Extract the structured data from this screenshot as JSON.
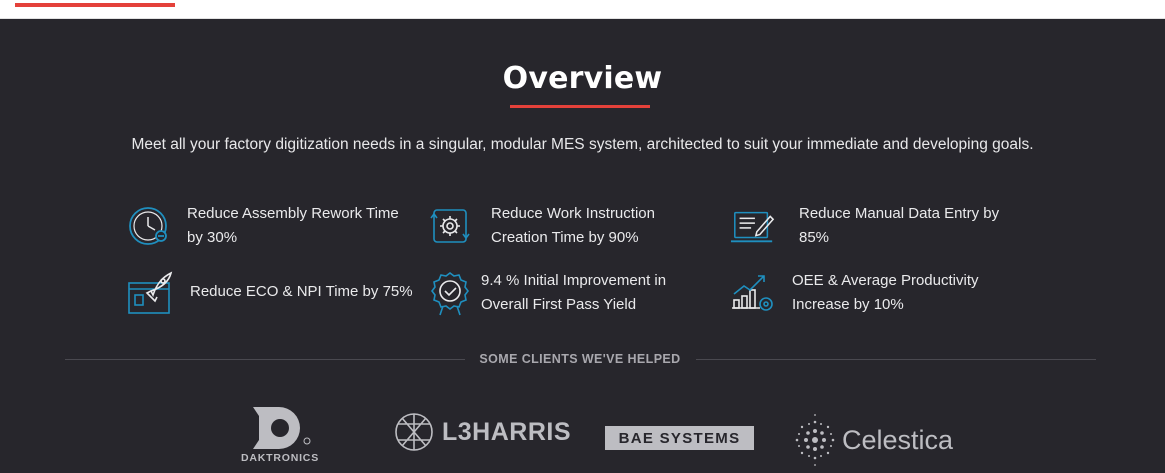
{
  "header": {
    "active_tab_color": "#e4413a"
  },
  "overview": {
    "title": "Overview",
    "subtitle": "Meet all your factory digitization needs in a singular, modular MES system, architected to suit your immediate and developing goals."
  },
  "stats": [
    {
      "line1": "Reduce Assembly Rework Time",
      "line2": "by 30%",
      "icon": "clock-icon"
    },
    {
      "line1": "Reduce Work Instruction",
      "line2": "Creation Time by 90%",
      "icon": "gear-cycle-icon"
    },
    {
      "line1": "Reduce Manual Data Entry by",
      "line2": "85%",
      "icon": "document-edit-icon"
    },
    {
      "line1": "Reduce ECO & NPI Time by 75%",
      "line2": "",
      "icon": "rocket-icon"
    },
    {
      "line1": "9.4 % Initial Improvement in",
      "line2": "Overall First Pass Yield",
      "icon": "badge-check-icon"
    },
    {
      "line1": "OEE & Average Productivity",
      "line2": "Increase by 10%",
      "icon": "chart-gear-icon"
    }
  ],
  "clients": {
    "label": "SOME CLIENTS WE'VE HELPED",
    "logos": [
      {
        "name": "DAKTRONICS"
      },
      {
        "name": "L3HARRIS"
      },
      {
        "name": "BAE SYSTEMS"
      },
      {
        "name": "Celestica"
      }
    ]
  },
  "colors": {
    "background": "#27262c",
    "accent": "#e4413a",
    "icon_blue": "#1f8fbf"
  }
}
